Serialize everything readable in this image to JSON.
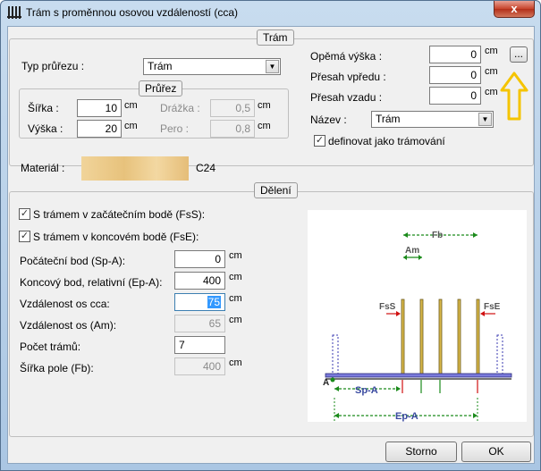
{
  "window": {
    "title": "Trám s proměnnou osovou vzdáleností (cca)",
    "close_label": "x"
  },
  "tram_group": {
    "title": "Trám",
    "typ_prurezu_label": "Typ průřezu :",
    "typ_prurezu_value": "Trám",
    "prurez_title": "Průřez",
    "sirka_label": "Šířka :",
    "sirka_value": "10",
    "sirka_unit": "cm",
    "vyska_label": "Výška :",
    "vyska_value": "20",
    "vyska_unit": "cm",
    "drazka_label": "Drážka :",
    "drazka_value": "0,5",
    "drazka_unit": "cm",
    "pero_label": "Pero :",
    "pero_value": "0,8",
    "pero_unit": "cm",
    "opemna_label": "Opěmá výška :",
    "opemna_value": "0",
    "opemna_unit": "cm",
    "presah_vpredu_label": "Přesah vpředu :",
    "presah_vpredu_value": "0",
    "presah_vpredu_unit": "cm",
    "presah_vzadu_label": "Přesah vzadu :",
    "presah_vzadu_value": "0",
    "presah_vzadu_unit": "cm",
    "ellipsis_label": "...",
    "nazev_label": "Název :",
    "nazev_value": "Trám",
    "definovat_label": "definovat jako trámování"
  },
  "material": {
    "label": "Materiál :",
    "value": "C24"
  },
  "deleni": {
    "title": "Dělení",
    "fss_label": "S trámem v začátečním bodě (FsS):",
    "fse_label": "S trámem v koncovém bodě (FsE):",
    "sp_label": "Počáteční bod  (Sp-A):",
    "sp_value": "0",
    "sp_unit": "cm",
    "ep_label": "Koncový bod, relativní  (Ep-A):",
    "ep_value": "400",
    "ep_unit": "cm",
    "cca_label": "Vzdálenost os cca:",
    "cca_value": "75",
    "cca_unit": "cm",
    "am_label": "Vzdálenost os (Am):",
    "am_value": "65",
    "am_unit": "cm",
    "pocet_label": "Počet trámů:",
    "pocet_value": "7",
    "fb_label": "Šířka pole (Fb):",
    "fb_value": "400",
    "fb_unit": "cm"
  },
  "diagram": {
    "fb": "Fb",
    "am": "Am",
    "fss": "FsS",
    "fse": "FsE",
    "a": "A",
    "spa": "Sp-A",
    "epa": "Ep-A"
  },
  "buttons": {
    "storno": "Storno",
    "ok": "OK"
  },
  "colors": {
    "accent_arrow": "#f5c400",
    "dim_green": "#1a8a1a",
    "beam_gold": "#c8a42a",
    "red": "#d01010"
  }
}
